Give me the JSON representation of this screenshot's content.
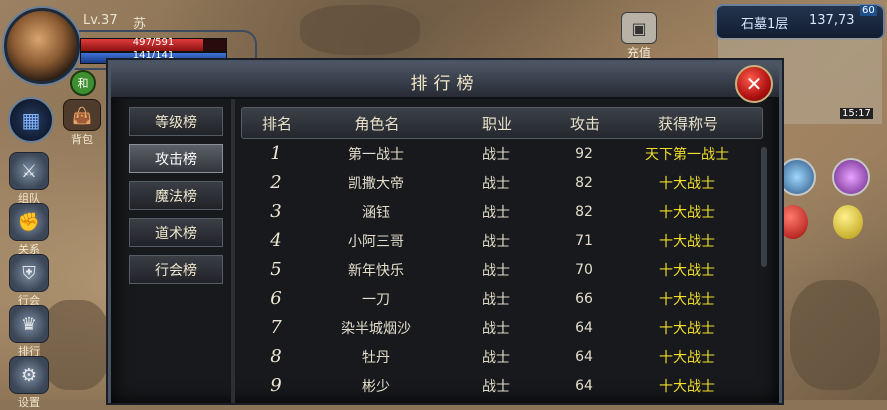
{
  "player": {
    "level": "Lv.37",
    "name": "苏",
    "hp": "497/591",
    "hp_fraction": 0.841,
    "mp": "141/141",
    "mp_fraction": 1.0,
    "badge": "和"
  },
  "side_menu": [
    {
      "label": "组队",
      "icon": "team-icon"
    },
    {
      "label": "关系",
      "icon": "relation-icon"
    },
    {
      "label": "行会",
      "icon": "guild-icon"
    },
    {
      "label": "排行",
      "icon": "rank-icon"
    },
    {
      "label": "设置",
      "icon": "settings-icon"
    }
  ],
  "bag_label": "背包",
  "charge_label": "充值",
  "map": {
    "name": "石墓1层",
    "coords": "137,73",
    "fps": "60",
    "clock": "15:17"
  },
  "panel": {
    "title": "排行榜",
    "tabs": [
      "等级榜",
      "攻击榜",
      "魔法榜",
      "道术榜",
      "行会榜"
    ],
    "active_tab": 1,
    "headers": [
      "排名",
      "角色名",
      "职业",
      "攻击",
      "获得称号"
    ],
    "rows": [
      {
        "rank": "1",
        "name": "第一战士",
        "job": "战士",
        "attack": "92",
        "title": "天下第一战士"
      },
      {
        "rank": "2",
        "name": "凯撒大帝",
        "job": "战士",
        "attack": "82",
        "title": "十大战士"
      },
      {
        "rank": "3",
        "name": "涵钰",
        "job": "战士",
        "attack": "82",
        "title": "十大战士"
      },
      {
        "rank": "4",
        "name": "小阿三哥",
        "job": "战士",
        "attack": "71",
        "title": "十大战士"
      },
      {
        "rank": "5",
        "name": "新年快乐",
        "job": "战士",
        "attack": "70",
        "title": "十大战士"
      },
      {
        "rank": "6",
        "name": "一刀",
        "job": "战士",
        "attack": "66",
        "title": "十大战士"
      },
      {
        "rank": "7",
        "name": "染半城烟沙",
        "job": "战士",
        "attack": "64",
        "title": "十大战士"
      },
      {
        "rank": "8",
        "name": "牡丹",
        "job": "战士",
        "attack": "64",
        "title": "十大战士"
      },
      {
        "rank": "9",
        "name": "彬少",
        "job": "战士",
        "attack": "64",
        "title": "十大战士"
      }
    ]
  },
  "colors": {
    "title_yellow": "#f2df2a",
    "panel_bg": "#17191c",
    "hp_red": "#e03b3b",
    "mp_blue": "#3f73d6"
  }
}
